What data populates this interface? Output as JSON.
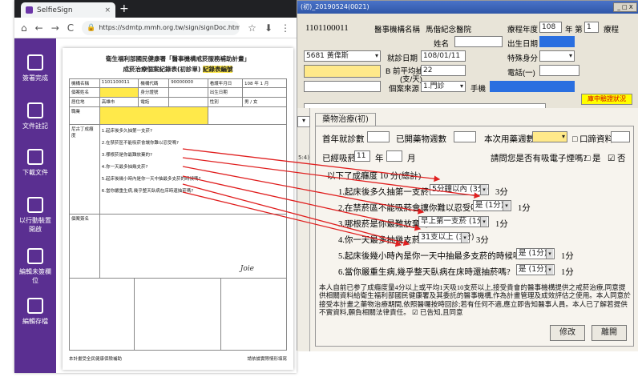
{
  "browser": {
    "tab_title": "SelfieSign",
    "tab_close": "×",
    "new_tab": "+",
    "nav": {
      "back": "⌂",
      "prev": "←",
      "next": "→",
      "reload": "C"
    },
    "url": "https://sdmtp.mmh.org.tw/sign/signDoc.html?docname=fil",
    "star": "☆",
    "download": "⬇",
    "menu": "⋮"
  },
  "sidebar": {
    "items": [
      {
        "label": "簽署完成",
        "icon": "document-check-icon"
      },
      {
        "label": "文件註記",
        "icon": "annotate-icon"
      },
      {
        "label": "下載文件",
        "icon": "download-doc-icon"
      },
      {
        "label": "以行動裝置開啟",
        "icon": "qr-code-icon"
      },
      {
        "label": "編輯未簽欄位",
        "icon": "edit-fields-icon"
      },
      {
        "label": "編輯存檔",
        "icon": "save-icon"
      }
    ]
  },
  "paper": {
    "title_1": "衛生福利部國民健康署「醫事機構戒菸服務補助計畫」",
    "title_2": "成菸治療個案紀錄表(初診單)",
    "highlight_tag": "紀錄表編號",
    "rows": [
      [
        "機構名稱",
        "1101100011",
        "機構代碼",
        "90000000",
        "看護年月日",
        "108 年 1 月"
      ],
      [
        "個案姓名",
        "",
        "身分證號",
        "",
        "出生日期",
        ""
      ],
      [
        "居住地",
        "高雄市",
        "電話",
        "",
        "性別",
        "男 / 女"
      ],
      [
        "職業",
        "",
        "婚姻",
        "",
        "教育",
        ""
      ]
    ],
    "section_label": "尼古丁成癮度",
    "questions": [
      "1.起床後多久抽第一支菸?",
      "2.在禁菸區不能吸菸會讓你難以忍受嗎?",
      "3.哪根菸是你最難放棄的?",
      "4.你一天最多抽幾支菸?",
      "5.起床後幾小時內是你一天中抽最多支菸的時候嗎?",
      "6.當你嚴重生病,幾乎整天臥病在床時還抽菸嗎?"
    ],
    "sig_label": "個案簽名",
    "signature": "Joie",
    "footer_left": "本計畫受全民健康保險補助",
    "footer_right": "請依據實際情形填寫"
  },
  "app": {
    "title": "(初)_20190524(0021)",
    "win_controls": "_ □ X",
    "id_value": "1101100011",
    "hosp_label": "醫事機構名稱",
    "hosp_value": "馬偕紀念醫院",
    "year_label": "療程年度",
    "year_value": "108",
    "count_label": "年 第",
    "count_value": "1",
    "count_suffix": "療程",
    "name_label": "姓名",
    "birth_label": "出生日期",
    "doctor_value": "5681 黃偉斯",
    "visit_label": "就診日期",
    "visit_value": "108/01/11",
    "status_label": "特殊身分",
    "smoke_label": "B 前平均抽菸量",
    "smoke_sub": "(支/天)",
    "smoke_value": "22",
    "phone_label": "電話(一)",
    "src_label": "個案來源",
    "src_value": "1.門診",
    "phone2_label": "手機",
    "lock_button": "庫中驗證狀況",
    "left_value": "5:4)",
    "tab_label": "藥物治療(初)",
    "first_visit_label": "首年就診數",
    "used_weeks_label": "已開藥物週數",
    "this_weeks_label": "本次用藥週數",
    "record_label": "□ 口蹄資料",
    "years_label": "已經吸菸",
    "years_value": "11",
    "years_unit": "年",
    "months_unit": "月",
    "ecig_label": "請問您是否有吸電子煙嗎?",
    "ecig_yes": "□ 是",
    "ecig_no": "☑ 否",
    "fag_header": "以下了成癮度 10 分(總計)",
    "q1": "1.起床後多久抽第一支菸?",
    "a1": "5分鐘以內 (3分)",
    "s1": "3分",
    "q2": "2.在禁菸區不能吸菸會讓你難以忍受嗎?",
    "a2": "是 (1分)",
    "s2": "1分",
    "q3": "3.哪根菸是你最難放棄的?",
    "a3": "早上第一支菸 (1分)",
    "s3": "1分",
    "q4": "4.你一天最多抽幾支菸?",
    "a4": "31支以上 (3分)",
    "s4": "3分",
    "q5": "5.起床後幾小時內是你一天中抽最多支菸的時候嗎?",
    "a5": "是 (1分)",
    "s5": "1分",
    "q6": "6.當你嚴重生病,幾乎整天臥病在床時還抽菸嗎?",
    "a6": "是 (1分)",
    "s6": "1分",
    "note": "本人自前已参了成癮度量4分以上或平均1天吸10支菸以上,接受貴會的醫事機構提供之戒菸治療,同意提供相關資料給衛生福利部國民健康署及其委託的醫事機構,作為計畫管理及成效評估之使用。本人同意於接受本計畫之藥物治療期間,依照醫囑按時回診;若有任何不適,應立即告知醫事人員。本人已了解若提供不實資料,願負相關法律責任。",
    "agree": "☑ 已告知,且同意",
    "edit_button": "修改",
    "leave_button": "離開"
  }
}
